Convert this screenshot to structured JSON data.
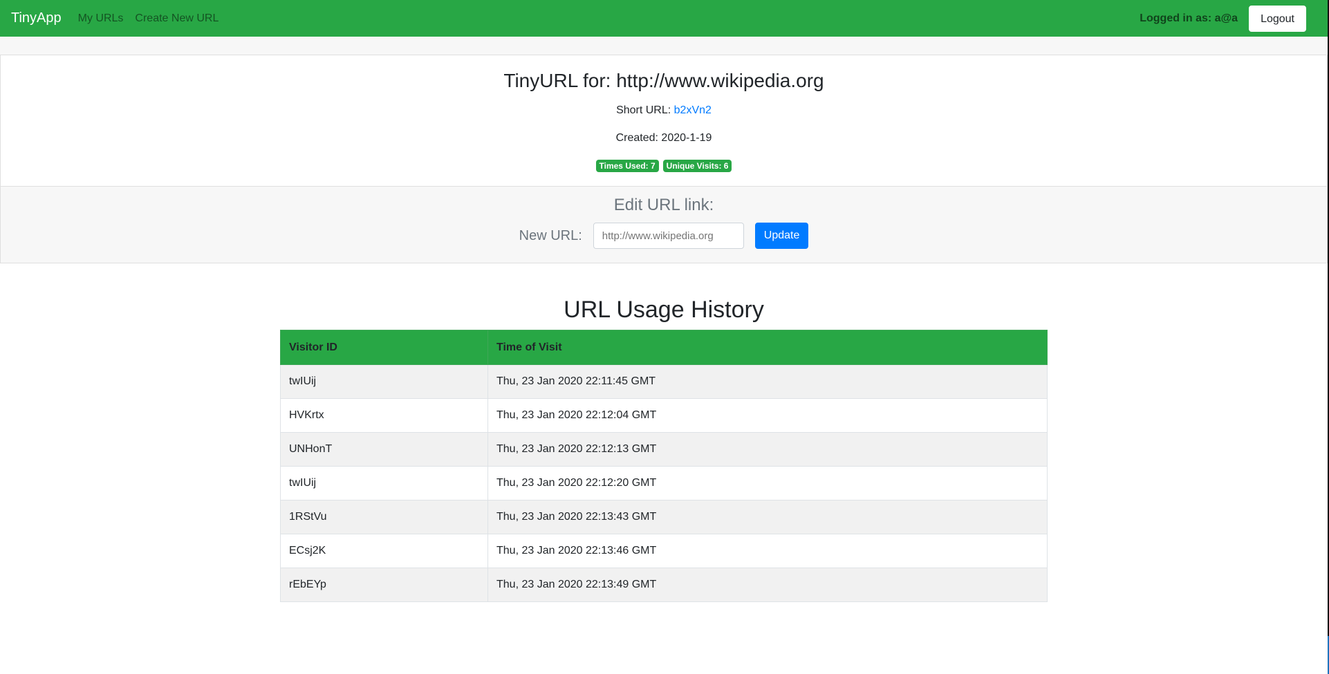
{
  "navbar": {
    "brand": "TinyApp",
    "links": [
      "My URLs",
      "Create New URL"
    ],
    "logged_in_text": "Logged in as: a@a",
    "logout_label": "Logout",
    "color": "#28a745"
  },
  "url": {
    "title": "TinyURL for: http://www.wikipedia.org",
    "short_url_label": "Short URL:",
    "short_url": "b2xVn2",
    "created": "Created: 2020-1-19",
    "times_used": "Times Used: 7",
    "unique_visits": "Unique Visits: 6"
  },
  "edit": {
    "title": "Edit URL link:",
    "new_url_label": "New URL:",
    "placeholder": "http://www.wikipedia.org",
    "update_label": "Update"
  },
  "history": {
    "title": "URL Usage History",
    "columns": [
      "Visitor ID",
      "Time of Visit"
    ],
    "rows": [
      [
        "twIUij",
        "Thu, 23 Jan 2020 22:11:45 GMT"
      ],
      [
        "HVKrtx",
        "Thu, 23 Jan 2020 22:12:04 GMT"
      ],
      [
        "UNHonT",
        "Thu, 23 Jan 2020 22:12:13 GMT"
      ],
      [
        "twIUij",
        "Thu, 23 Jan 2020 22:12:20 GMT"
      ],
      [
        "1RStVu",
        "Thu, 23 Jan 2020 22:13:43 GMT"
      ],
      [
        "ECsj2K",
        "Thu, 23 Jan 2020 22:13:46 GMT"
      ],
      [
        "rEbEYp",
        "Thu, 23 Jan 2020 22:13:49 GMT"
      ]
    ]
  }
}
